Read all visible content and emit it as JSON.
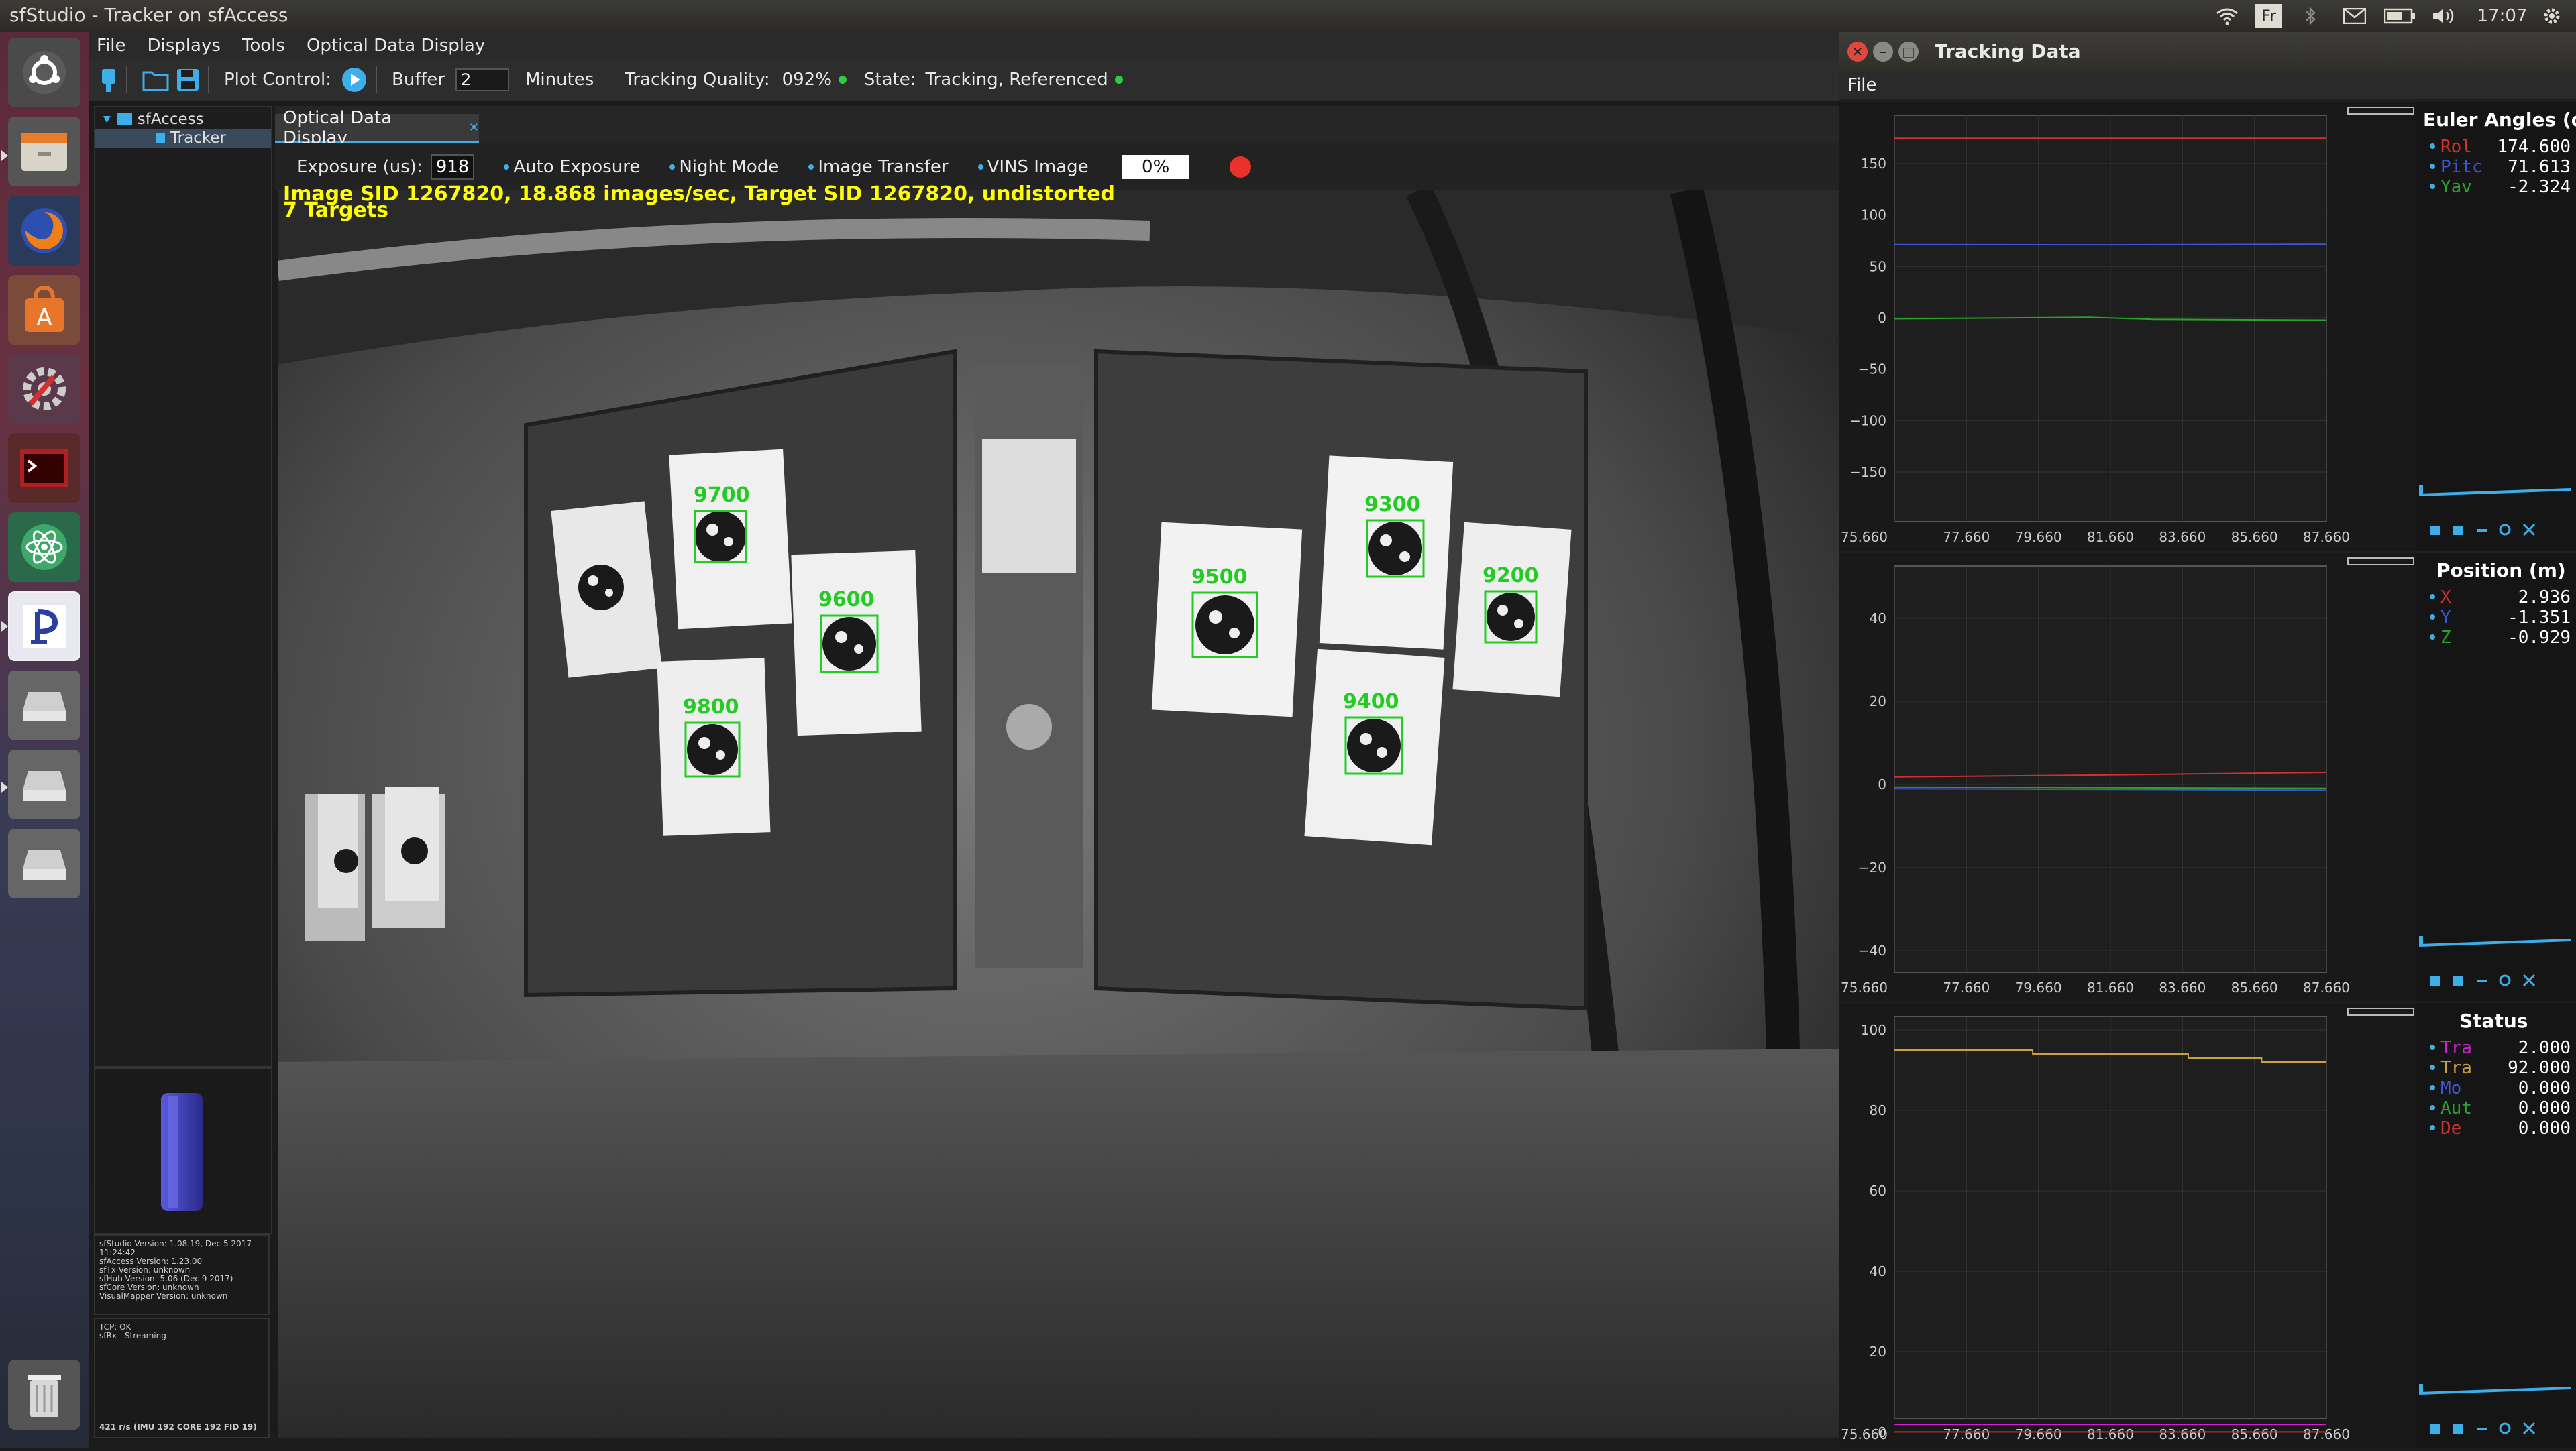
{
  "topbar": {
    "app_title": "sfStudio - Tracker on sfAccess",
    "keyboard": "Fr",
    "clock": "17:07"
  },
  "launcher": {
    "icons": [
      "ubuntu-dash-icon",
      "files-icon",
      "firefox-icon",
      "software-center-icon",
      "system-settings-icon",
      "terminal-icon",
      "atom-icon",
      "sfstudio-icon",
      "drive-icon",
      "drive-icon",
      "drive-icon",
      "trash-icon"
    ]
  },
  "menu": {
    "file": "File",
    "displays": "Displays",
    "tools": "Tools",
    "optical": "Optical Data Display"
  },
  "toolbar": {
    "plot_control": "Plot Control:",
    "buffer_label": "Buffer",
    "buffer_value": "2",
    "minutes": "Minutes",
    "quality_label": "Tracking Quality:",
    "quality_value": "092%",
    "state_label": "State:",
    "state_value": "Tracking, Referenced"
  },
  "tree": {
    "root": "sfAccess",
    "child": "Tracker"
  },
  "info": {
    "versions": [
      "sfStudio Version: 1.08.19, Dec  5 2017",
      "11:24:42",
      "sfAccess Version: 1.23.00",
      "sfTx Version: unknown",
      "sfHub Version: 5.06 (Dec  9 2017)",
      "sfCore Version: unknown",
      "VisualMapper Version: unknown"
    ],
    "tcp": [
      "TCP: OK",
      "sfRx - Streaming"
    ],
    "rate": "421 r/s (IMU 192  CORE 192  FID 19)"
  },
  "display": {
    "tab": "Optical Data Display",
    "exposure_label": "Exposure (us):",
    "exposure_value": "918",
    "auto_exposure": "Auto Exposure",
    "night_mode": "Night Mode",
    "image_transfer": "Image Transfer",
    "vins_image": "VINS Image",
    "progress": "0%",
    "overlay_line1": "Image SID 1267820, 18.868 images/sec, Target SID 1267820, undistorted",
    "overlay_line2": "7 Targets",
    "targets": [
      "9700",
      "9600",
      "9800",
      "9500",
      "9300",
      "9200",
      "9400"
    ]
  },
  "tracking": {
    "title": "Tracking Data",
    "file_menu": "File",
    "x_ticks": [
      "75.660",
      "77.660",
      "79.660",
      "81.660",
      "83.660",
      "85.660",
      "87.660"
    ],
    "colors": {
      "red": "#d0312d",
      "blue": "#3b57d8",
      "green": "#29a329",
      "magenta": "#d21fd2",
      "orange": "#c8a040"
    },
    "euler": {
      "title": "Euler Angles (de",
      "y_ticks": [
        "150",
        "100",
        "50",
        "0",
        "−50",
        "−100",
        "−150"
      ],
      "rows": [
        {
          "name": "Rol",
          "value": "174.600",
          "color": "#d0312d"
        },
        {
          "name": "Pitc",
          "value": "71.613",
          "color": "#3b57d8"
        },
        {
          "name": "Yav",
          "value": "-2.324",
          "color": "#29a329"
        }
      ]
    },
    "position": {
      "title": "Position (m)",
      "y_ticks": [
        "40",
        "20",
        "0",
        "−20",
        "−40"
      ],
      "rows": [
        {
          "name": "X",
          "value": "2.936",
          "color": "#d0312d"
        },
        {
          "name": "Y",
          "value": "-1.351",
          "color": "#3b57d8"
        },
        {
          "name": "Z",
          "value": "-0.929",
          "color": "#29a329"
        }
      ]
    },
    "status": {
      "title": "Status",
      "y_ticks": [
        "100",
        "80",
        "60",
        "40",
        "20",
        "0"
      ],
      "rows": [
        {
          "name": "Tra",
          "value": "2.000",
          "color": "#d21fd2"
        },
        {
          "name": "Tra",
          "value": "92.000",
          "color": "#c8a040"
        },
        {
          "name": "Mo",
          "value": "0.000",
          "color": "#3b57d8"
        },
        {
          "name": "Aut",
          "value": "0.000",
          "color": "#29a329"
        },
        {
          "name": "De",
          "value": "0.000",
          "color": "#d0312d"
        }
      ]
    }
  }
}
